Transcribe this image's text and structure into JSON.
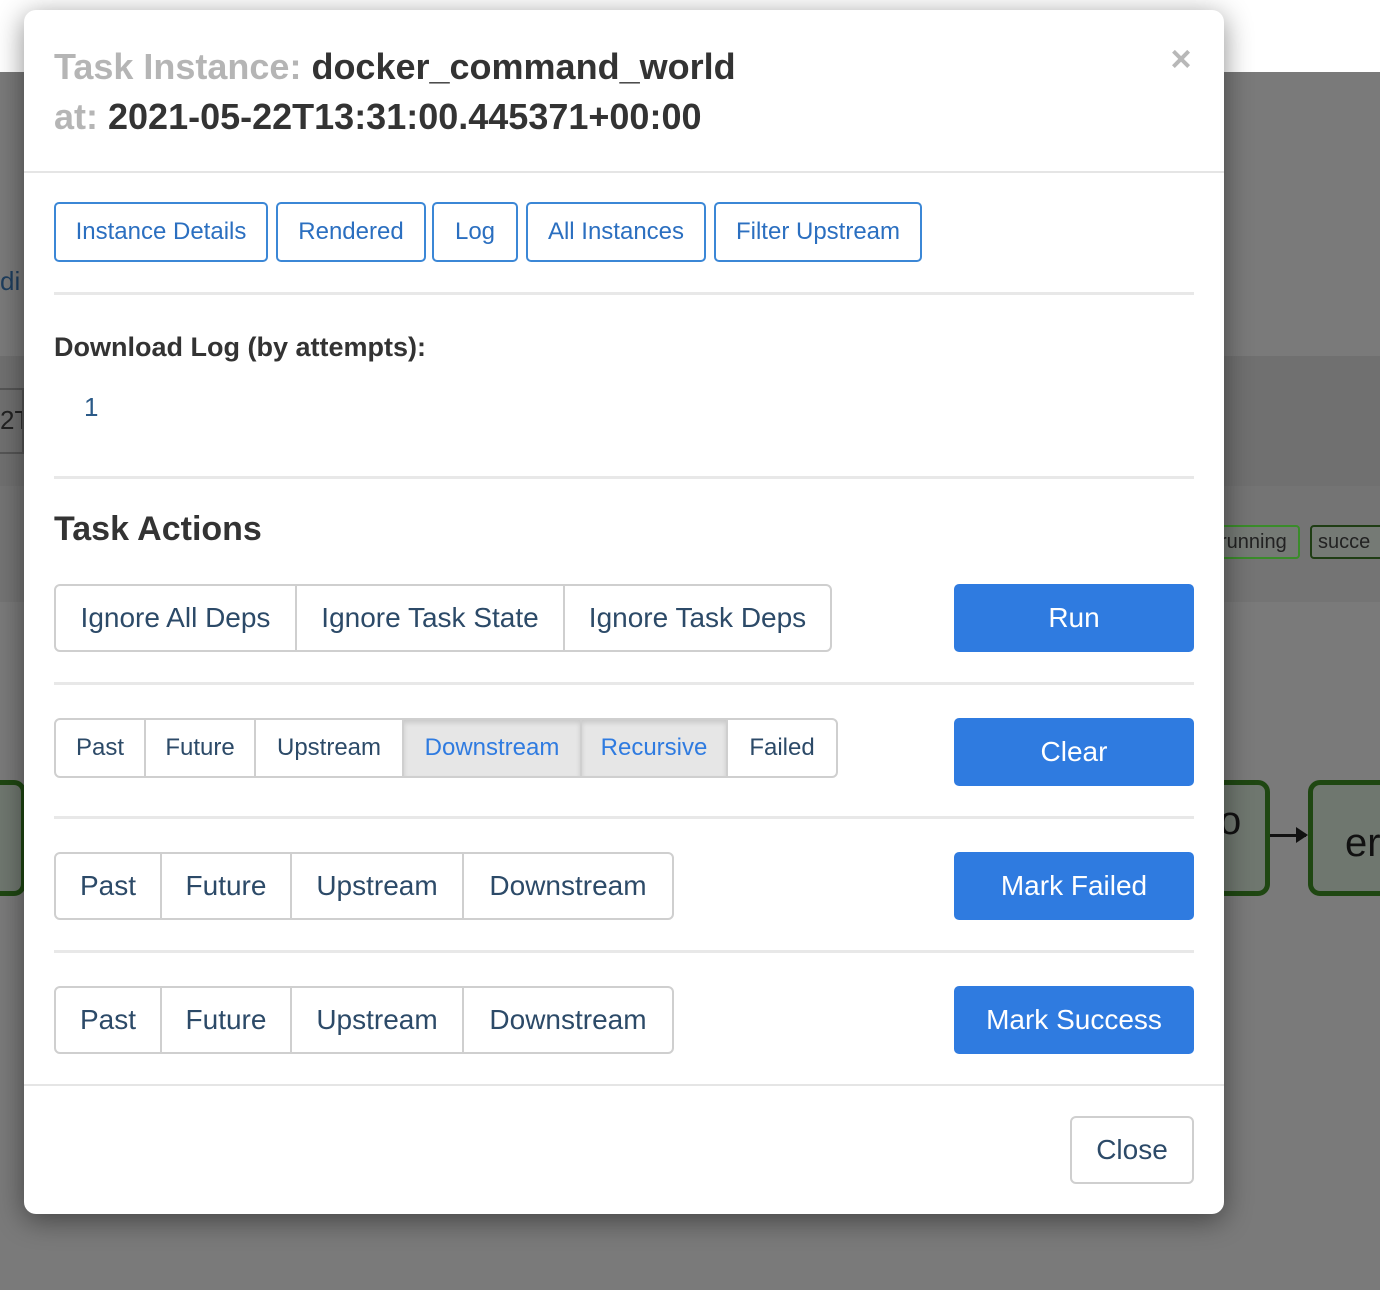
{
  "background": {
    "fragments": {
      "left_link": "di",
      "left_box": "2T",
      "node_left": "o",
      "node_right": "er"
    },
    "legend": {
      "running": "running",
      "success": "succe"
    }
  },
  "modal": {
    "title": {
      "task_prefix": "Task Instance:",
      "task_id": "docker_command_world",
      "at_prefix": "at:",
      "execution_date": "2021-05-22T13:31:00.445371+00:00"
    },
    "close_icon": "×",
    "nav": [
      {
        "label": "Instance Details"
      },
      {
        "label": "Rendered"
      },
      {
        "label": "Log"
      },
      {
        "label": "All Instances"
      },
      {
        "label": "Filter Upstream"
      }
    ],
    "download_log": {
      "label": "Download Log (by attempts):",
      "attempts": [
        "1"
      ]
    },
    "task_actions": {
      "title": "Task Actions",
      "run": {
        "options": [
          {
            "label": "Ignore All Deps",
            "active": false
          },
          {
            "label": "Ignore Task State",
            "active": false
          },
          {
            "label": "Ignore Task Deps",
            "active": false
          }
        ],
        "button": "Run"
      },
      "clear": {
        "options": [
          {
            "label": "Past",
            "active": false
          },
          {
            "label": "Future",
            "active": false
          },
          {
            "label": "Upstream",
            "active": false
          },
          {
            "label": "Downstream",
            "active": true
          },
          {
            "label": "Recursive",
            "active": true
          },
          {
            "label": "Failed",
            "active": false
          }
        ],
        "button": "Clear"
      },
      "mark_failed": {
        "options": [
          {
            "label": "Past",
            "active": false
          },
          {
            "label": "Future",
            "active": false
          },
          {
            "label": "Upstream",
            "active": false
          },
          {
            "label": "Downstream",
            "active": false
          }
        ],
        "button": "Mark Failed"
      },
      "mark_success": {
        "options": [
          {
            "label": "Past",
            "active": false
          },
          {
            "label": "Future",
            "active": false
          },
          {
            "label": "Upstream",
            "active": false
          },
          {
            "label": "Downstream",
            "active": false
          }
        ],
        "button": "Mark Success"
      }
    },
    "footer": {
      "close_label": "Close"
    }
  }
}
